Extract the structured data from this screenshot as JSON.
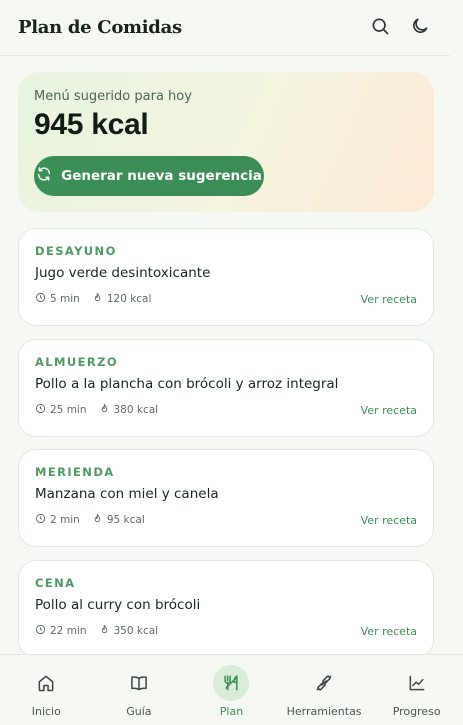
{
  "header": {
    "title": "Plan de Comidas",
    "actions": [
      {
        "icon": "search-icon"
      },
      {
        "icon": "moon-icon"
      }
    ]
  },
  "hero": {
    "label": "Menú sugerido para hoy",
    "total_kcal": "945 kcal",
    "button_label": "Generar nueva sugerencia",
    "button_icon": "refresh-icon"
  },
  "meals": [
    {
      "type": "DESAYUNO",
      "name": "Jugo verde desintoxicante",
      "time": "5 min",
      "kcal": "120 kcal",
      "link": "Ver receta"
    },
    {
      "type": "ALMUERZO",
      "name": "Pollo a la plancha con brócoli y arroz integral",
      "time": "25 min",
      "kcal": "380 kcal",
      "link": "Ver receta"
    },
    {
      "type": "MERIENDA",
      "name": "Manzana con miel y canela",
      "time": "2 min",
      "kcal": "95 kcal",
      "link": "Ver receta"
    },
    {
      "type": "CENA",
      "name": "Pollo al curry con brócoli",
      "time": "22 min",
      "kcal": "350 kcal",
      "link": "Ver receta"
    }
  ],
  "nav": {
    "items": [
      {
        "label": "Inicio",
        "icon": "home-icon"
      },
      {
        "label": "Guía",
        "icon": "book-icon"
      },
      {
        "label": "Plan",
        "icon": "utensils-icon"
      },
      {
        "label": "Herramientas",
        "icon": "dumbbell-icon"
      },
      {
        "label": "Progreso",
        "icon": "chart-icon"
      }
    ],
    "active": "Plan"
  },
  "colors": {
    "accent": "#3b8f56",
    "meal_type": "#4e9a62",
    "background": "#f6f8f3",
    "active_nav_bg": "#d9ebd9"
  }
}
